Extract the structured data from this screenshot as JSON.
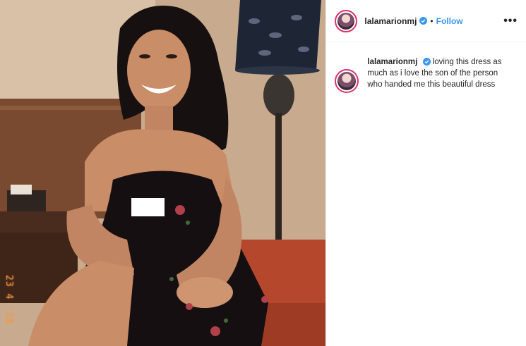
{
  "post": {
    "username": "lalamarionmj",
    "separator": "•",
    "follow_label": "Follow",
    "more_label": "•••",
    "caption": "loving this dress as much as i love the son of the person who handed me this beautiful dress"
  },
  "photo": {
    "date_stamp": "23 4 '19"
  },
  "colors": {
    "link_blue": "#3897f0",
    "verified_blue": "#3897f0",
    "avatar_ring": "#e1306c"
  }
}
